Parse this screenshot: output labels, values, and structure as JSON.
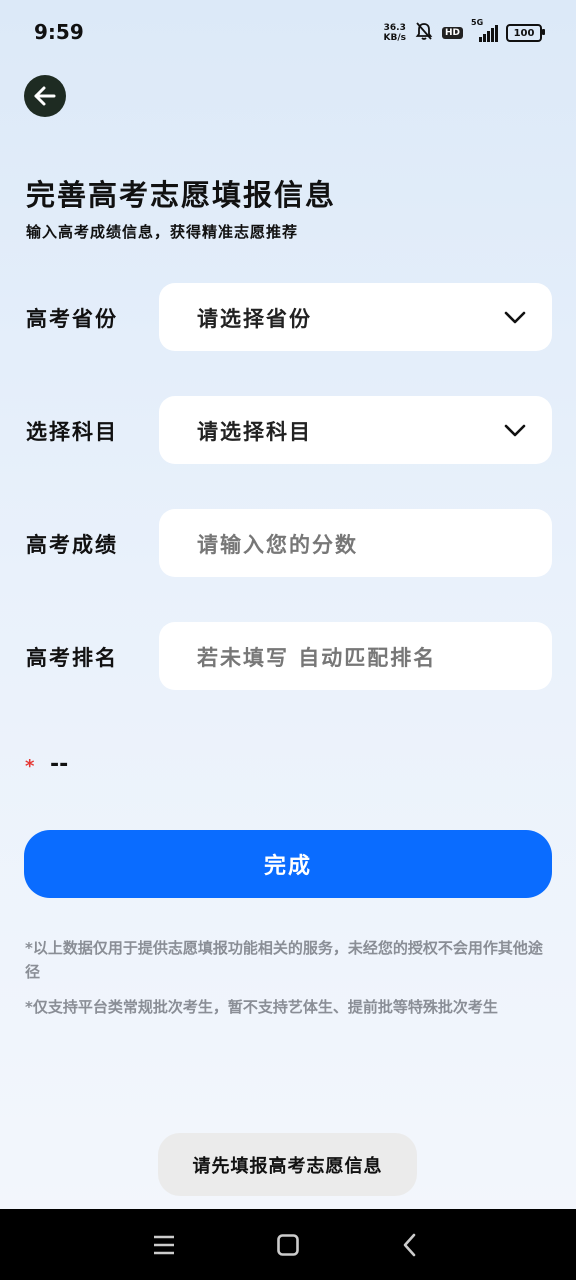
{
  "status_bar": {
    "time": "9:59",
    "net_speed_value": "36.3",
    "net_speed_unit": "KB/s",
    "hd_label": "HD",
    "network_label": "5G",
    "battery": "100"
  },
  "page": {
    "title": "完善高考志愿填报信息",
    "subtitle": "输入高考成绩信息，获得精准志愿推荐"
  },
  "form": {
    "province": {
      "label": "高考省份",
      "value": "请选择省份"
    },
    "subject": {
      "label": "选择科目",
      "value": "请选择科目"
    },
    "score": {
      "label": "高考成绩",
      "placeholder": "请输入您的分数"
    },
    "rank": {
      "label": "高考排名",
      "placeholder": "若未填写 自动匹配排名"
    },
    "required_star": "*",
    "summary": "--"
  },
  "actions": {
    "done_label": "完成"
  },
  "notes": [
    "*以上数据仅用于提供志愿填报功能相关的服务，未经您的授权不会用作其他途径",
    "*仅支持平台类常规批次考生，暂不支持艺体生、提前批等特殊批次考生"
  ],
  "toast": {
    "message": "请先填报高考志愿信息"
  },
  "colors": {
    "accent": "#0a6cff",
    "back_button": "#1e2b22",
    "required": "#e53935"
  }
}
